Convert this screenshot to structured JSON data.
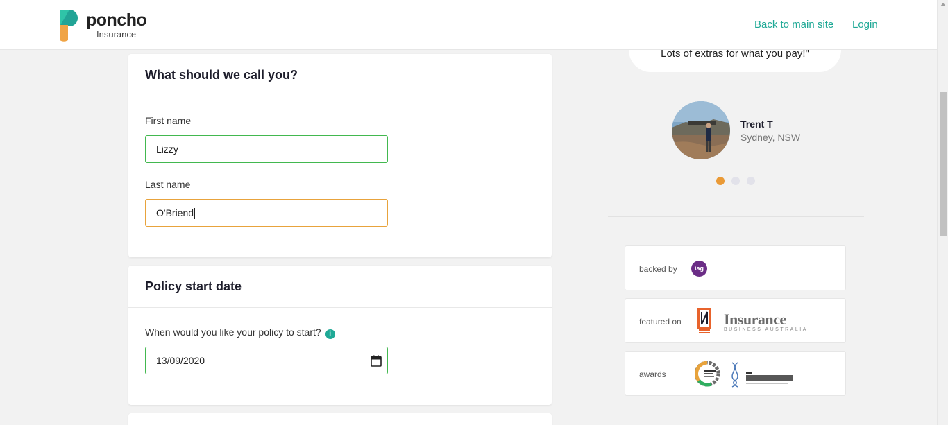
{
  "header": {
    "logo_word": "poncho",
    "logo_sub": "Insurance",
    "nav_back": "Back to main site",
    "nav_login": "Login"
  },
  "name_card": {
    "title": "What should we call you?",
    "first_name_label": "First name",
    "first_name_value": "Lizzy",
    "last_name_label": "Last name",
    "last_name_value": "O'Briend"
  },
  "policy_card": {
    "title": "Policy start date",
    "start_label": "When would you like your policy to start?",
    "start_value": "13/09/2020",
    "info_icon": "i"
  },
  "testimonial": {
    "quote": "Lots of extras for what you pay!\"",
    "name": "Trent T",
    "location": "Sydney, NSW",
    "carousel_active_index": 0,
    "carousel_count": 3
  },
  "badges": {
    "backed_by_label": "backed by",
    "backed_by_logo": "iag",
    "featured_on_label": "featured on",
    "featured_logo_text": "Insurance",
    "featured_logo_sub": "BUSINESS AUSTRALIA",
    "awards_label": "awards"
  },
  "colors": {
    "accent": "#1fa996",
    "valid_border": "#42b84f",
    "focus_border": "#e8a33c",
    "carousel_active": "#ea9a36"
  }
}
